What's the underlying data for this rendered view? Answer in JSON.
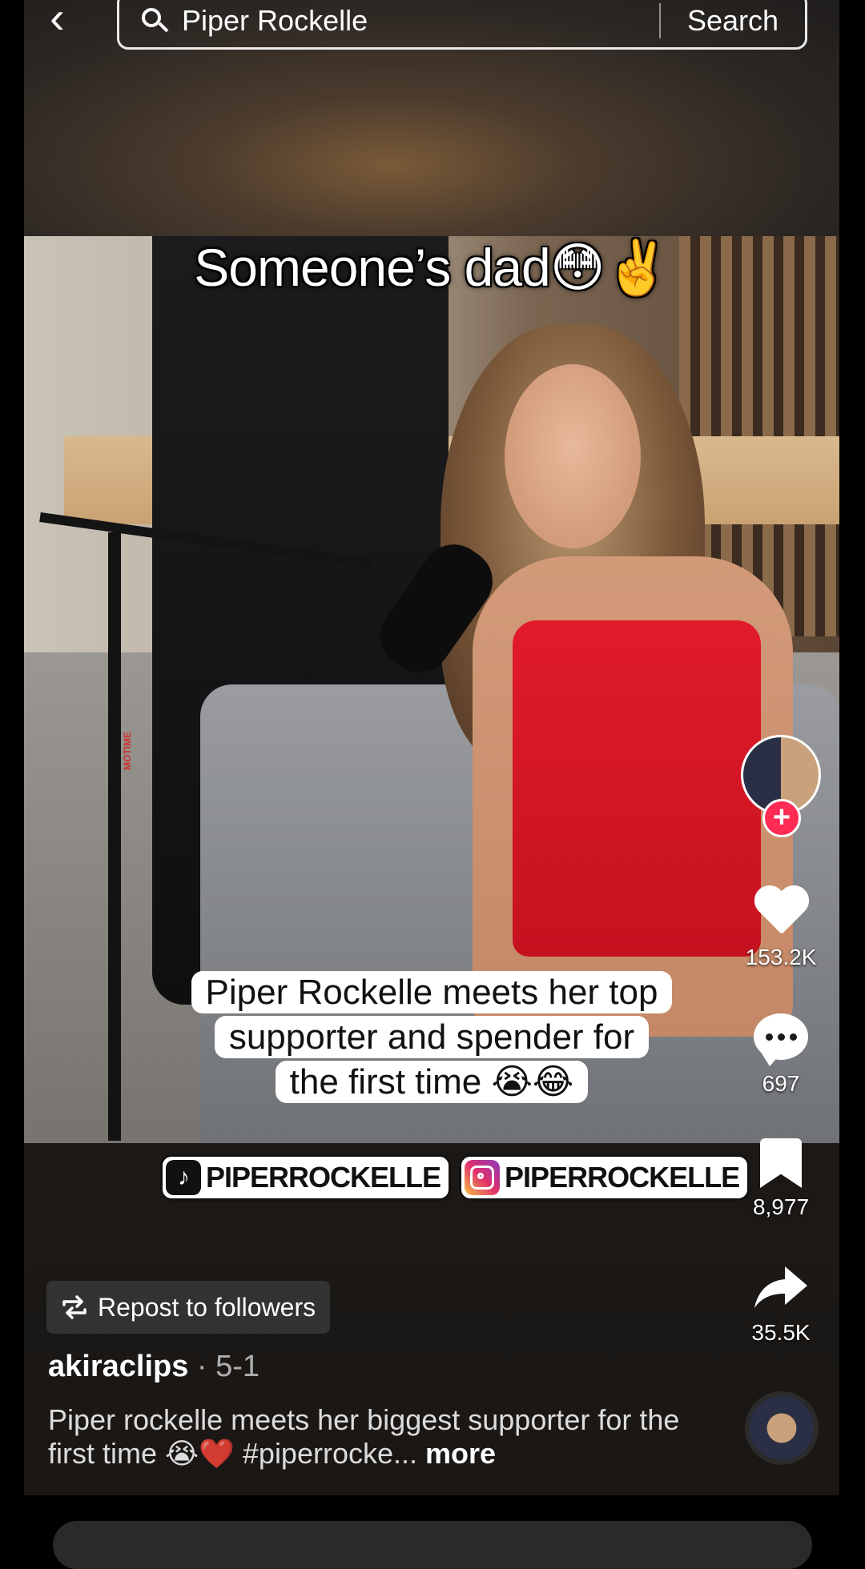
{
  "search": {
    "query": "Piper Rockelle",
    "button_label": "Search"
  },
  "video": {
    "top_caption": "Someone’s dad😳✌️",
    "subtitle_line1": "Piper Rockelle meets her top",
    "subtitle_line2": "supporter and spender for",
    "subtitle_line3": "the first time 😭😂",
    "handle_tiktok": "PIPERROCKELLE",
    "handle_instagram": "PIPERROCKELLE",
    "stand_text": "MOTIME"
  },
  "rail": {
    "likes": "153.2K",
    "comments": "697",
    "saves": "8,977",
    "shares": "35.5K",
    "follow_symbol": "+"
  },
  "post": {
    "repost_label": "Repost to followers",
    "author": "akiraclips",
    "date": " · 5-1",
    "description": "Piper rockelle meets her biggest supporter for the first time 😭❤️ #piperrocke...",
    "more_label": " more"
  },
  "colors": {
    "follow_accent": "#fe2c55",
    "dress_red": "#e11b2a"
  },
  "icons": {
    "back": "chevron-left-icon",
    "search": "search-icon",
    "like": "heart-icon",
    "comment": "comment-icon",
    "save": "bookmark-icon",
    "share": "share-icon",
    "repost": "repost-icon",
    "music": "music-disc-icon"
  }
}
